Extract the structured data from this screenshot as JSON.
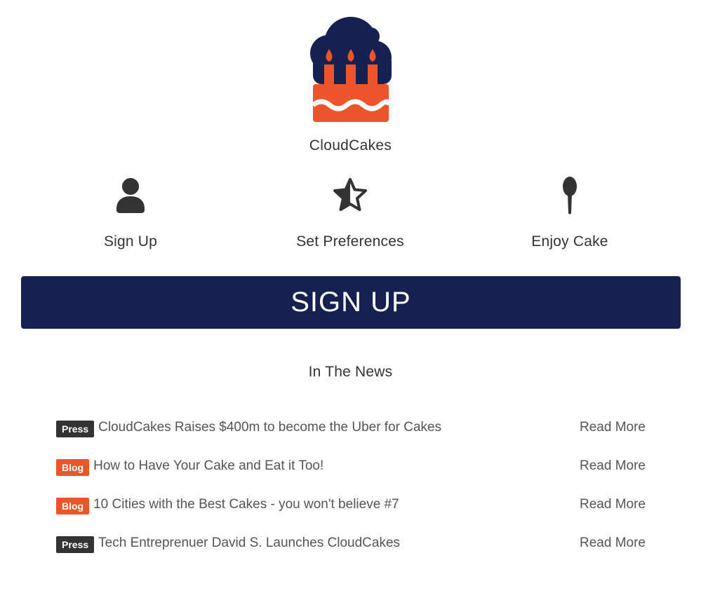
{
  "brand": {
    "name": "CloudCakes"
  },
  "steps": [
    {
      "label": "Sign Up",
      "icon": "user-icon"
    },
    {
      "label": "Set Preferences",
      "icon": "star-half-icon"
    },
    {
      "label": "Enjoy Cake",
      "icon": "spoon-icon"
    }
  ],
  "cta": {
    "label": "SIGN UP"
  },
  "news": {
    "heading": "In The News",
    "items": [
      {
        "tag": "Press",
        "title": "CloudCakes Raises $400m to become the Uber for Cakes",
        "link": "Read More"
      },
      {
        "tag": "Blog",
        "title": "How to Have Your Cake and Eat it Too!",
        "link": "Read More"
      },
      {
        "tag": "Blog",
        "title": "10 Cities with the Best Cakes - you won't believe #7",
        "link": "Read More"
      },
      {
        "tag": "Press",
        "title": "Tech Entreprenuer David S. Launches CloudCakes",
        "link": "Read More"
      }
    ]
  },
  "colors": {
    "navy": "#172151",
    "orange": "#ec5429",
    "dark": "#333333"
  }
}
